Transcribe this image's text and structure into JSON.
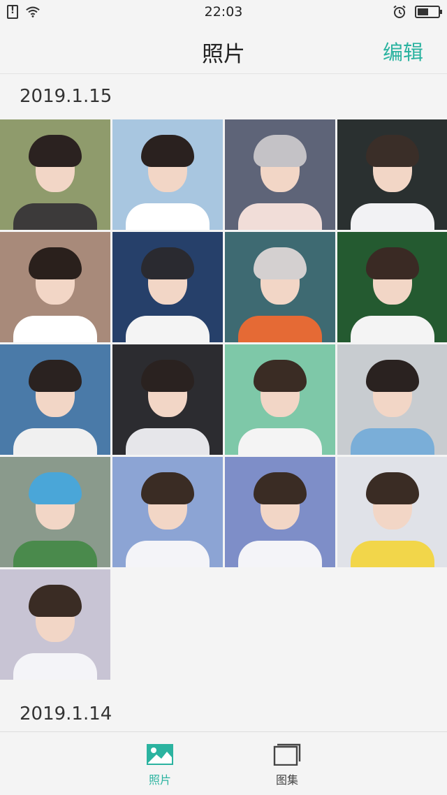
{
  "status_bar": {
    "time": "22:03",
    "battery_level": 0.55,
    "icons": [
      "sim-alert-icon",
      "wifi-icon",
      "alarm-icon",
      "battery-icon"
    ]
  },
  "nav": {
    "title": "照片",
    "edit_label": "编辑"
  },
  "colors": {
    "accent": "#2bb3a0",
    "background": "#f4f4f4",
    "text": "#222222"
  },
  "sections": [
    {
      "date": "2019.1.15",
      "photos": [
        {
          "bg": "#8f9b6c",
          "hair": "#2b2220",
          "body": "#3c3a3a"
        },
        {
          "bg": "#a8c6e0",
          "hair": "#2a211f",
          "body": "#ffffff"
        },
        {
          "bg": "#5e6478",
          "hair": "#c4c2c6",
          "body": "#f1ddd8"
        },
        {
          "bg": "#2a3030",
          "hair": "#3a2e28",
          "body": "#f2f2f4"
        },
        {
          "bg": "#a88a7a",
          "hair": "#2a201c",
          "body": "#ffffff"
        },
        {
          "bg": "#26406a",
          "hair": "#2a2a30",
          "body": "#f4f4f4"
        },
        {
          "bg": "#3e6a72",
          "hair": "#d4d0d0",
          "body": "#e56a35"
        },
        {
          "bg": "#245a30",
          "hair": "#3a2a24",
          "body": "#f4f4f4"
        },
        {
          "bg": "#4a7aa8",
          "hair": "#2a2220",
          "body": "#f0f0f0"
        },
        {
          "bg": "#2c2c30",
          "hair": "#2a2220",
          "body": "#e6e6ea"
        },
        {
          "bg": "#7ec8a8",
          "hair": "#3a2c24",
          "body": "#f4f4f4"
        },
        {
          "bg": "#c8ccd0",
          "hair": "#2a2220",
          "body": "#7aaed8"
        },
        {
          "bg": "#8a9a8c",
          "hair": "#4aa6d8",
          "body": "#4a8a4c"
        },
        {
          "bg": "#8ca4d4",
          "hair": "#3a2c24",
          "body": "#f4f4f8"
        },
        {
          "bg": "#7e8ec8",
          "hair": "#3a2c24",
          "body": "#f4f4f8"
        },
        {
          "bg": "#e0e2e8",
          "hair": "#3a2c24",
          "body": "#f2d64a"
        },
        {
          "bg": "#c8c4d4",
          "hair": "#3a2c24",
          "body": "#f4f4f8"
        }
      ]
    },
    {
      "date": "2019.1.14",
      "photos": []
    }
  ],
  "tab_bar": {
    "photos_label": "照片",
    "albums_label": "图集",
    "active": "photos"
  }
}
